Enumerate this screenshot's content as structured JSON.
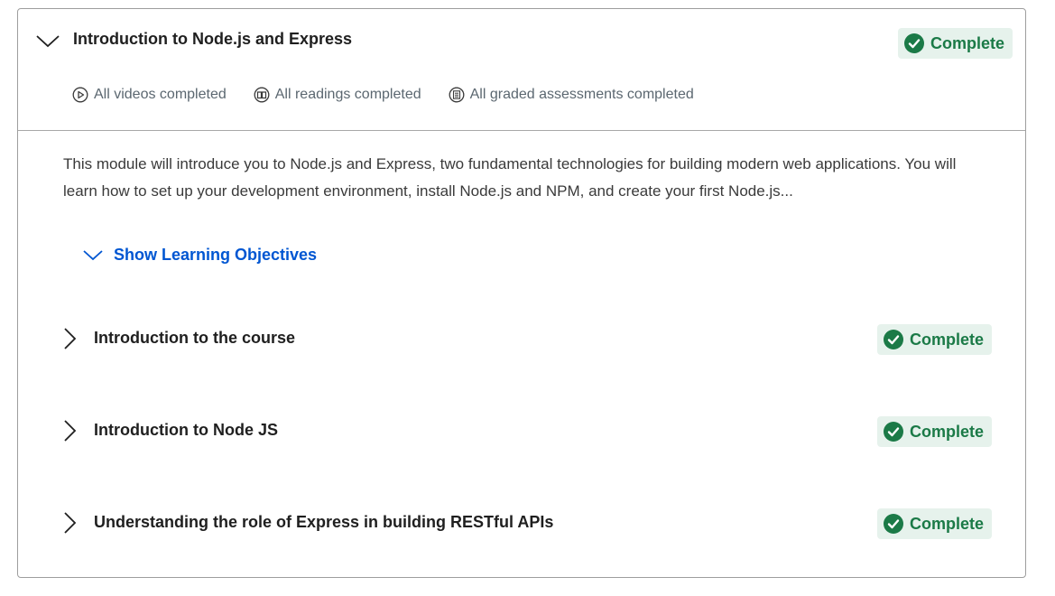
{
  "module": {
    "title": "Introduction to Node.js and Express",
    "status": "Complete",
    "summary": {
      "videos": "All videos completed",
      "readings": "All readings completed",
      "assessments": "All graded assessments completed"
    },
    "description": "This module will introduce you to Node.js and Express, two fundamental technologies for building modern web applications. You will learn how to set up your development environment, install Node.js and NPM, and create your first Node.js...",
    "objectives_toggle_label": "Show Learning Objectives"
  },
  "lessons": [
    {
      "title": "Introduction to the course",
      "status": "Complete"
    },
    {
      "title": "Introduction to Node JS",
      "status": "Complete"
    },
    {
      "title": "Understanding the role of Express in building RESTful APIs",
      "status": "Complete"
    }
  ],
  "colors": {
    "success_text": "#1b7a47",
    "success_bg": "#e6f2ec",
    "link": "#0056d2",
    "border": "#9e9e9e"
  },
  "icons": {
    "collapse": "chevron-down-icon",
    "expand": "chevron-right-icon",
    "status": "check-circle-icon",
    "videos": "play-circle-icon",
    "readings": "book-icon",
    "assessments": "assessment-icon"
  }
}
